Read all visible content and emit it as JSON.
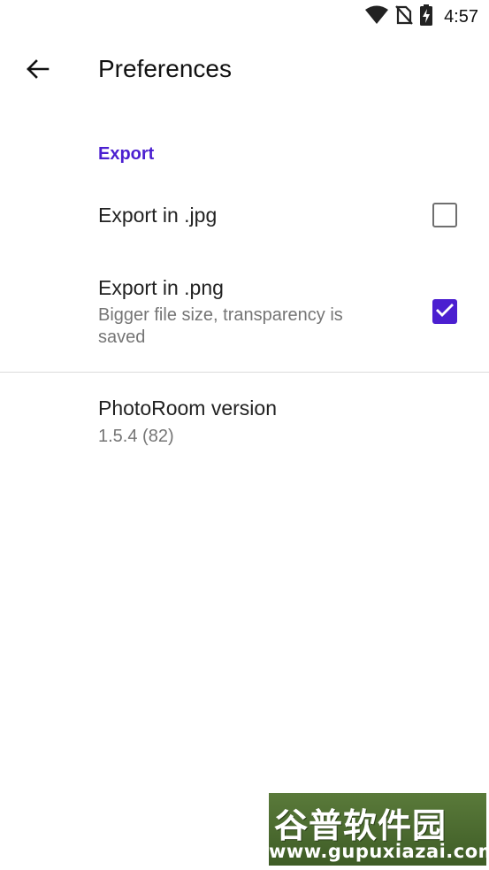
{
  "status_bar": {
    "time": "4:57",
    "icons": [
      "wifi-icon",
      "no-sim-icon",
      "battery-charging-icon"
    ]
  },
  "app_bar": {
    "back_icon": "arrow-back-icon",
    "title": "Preferences"
  },
  "export_section": {
    "header": "Export",
    "items": [
      {
        "title": "Export in .jpg",
        "summary": "",
        "checked": false
      },
      {
        "title": "Export in .png",
        "summary": "Bigger file size, transparency is saved",
        "checked": true
      }
    ]
  },
  "about": {
    "title": "PhotoRoom version",
    "summary": "1.5.4 (82)"
  },
  "watermark": {
    "chinese_text": "谷普软件园",
    "url": "www.gupuxiazai.com"
  },
  "colors": {
    "accent": "#4b1fd0",
    "summary_text": "#757575"
  }
}
